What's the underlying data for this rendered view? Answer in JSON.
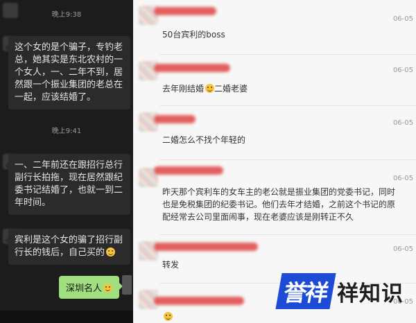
{
  "left_chat": {
    "time1": "晚上9:38",
    "msg1": "这个女的是个骗子，专钓老总，她其实是东北农村的一个女人，一、二年不到，居然跟一个振业集团的老总在一起，应该结婚了。",
    "time2": "晚上9:41",
    "msg2": "一、二年前还在跟招行总行副行长拍拖，现在居然跟纪委书记结婚了，也就一到二年时间。",
    "msg3": "宾利是这个女的骗了招行副行长的钱后，自己买的",
    "msg3_emoji": "emoji-smile",
    "my_msg": "深圳名人",
    "my_msg_emoji": "emoji-smile"
  },
  "comments": [
    {
      "date": "06-05",
      "text": "50台宾利的boss"
    },
    {
      "date": "06-05",
      "text": "去年刚结婚",
      "emoji": "emoji-laugh",
      "text_after": "二婚老婆"
    },
    {
      "date": "06-05",
      "text": "二婚怎么不找个年轻的"
    },
    {
      "date": "06-05",
      "line1": "昨天那个宾利车的女车主的老公就是振业集团的党委书记，同时",
      "line2": "也是免税集团的纪委书记。他们去年才结婚，之前这个书记的原",
      "line3": "配经常去公司里面闹事，现在老婆应该是刚转正不久"
    },
    {
      "date": "06-05",
      "text": "转发"
    },
    {
      "date": "06-05",
      "emoji": "emoji-laugh"
    }
  ],
  "watermark": {
    "badge": "誉祥",
    "text": "祥知识",
    "color": "#1e4bd6"
  }
}
